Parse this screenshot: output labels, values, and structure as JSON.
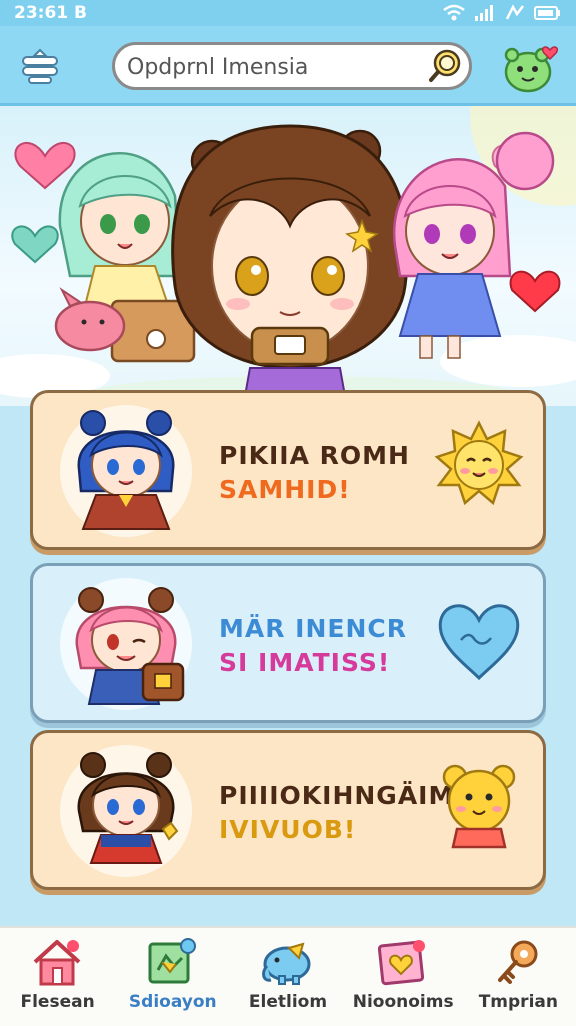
{
  "status_bar": {
    "time": "23:61 B"
  },
  "topbar": {
    "search": {
      "value": "Opdprnl Imensia"
    },
    "icons": [
      "menu-icon",
      "search-icon",
      "green-pet-heart-icon"
    ]
  },
  "cards": [
    {
      "line1": "PIKIIA ROMH",
      "line2": "SAMHID!",
      "line1_color": "#4a2a16",
      "line2_color": "#ef6a1e",
      "deco": "sun-smiley-icon"
    },
    {
      "line1": "MÄR INENCR",
      "line2": "SI IMATISS!",
      "line1_color": "#3d8bd4",
      "line2_color": "#d63b9c",
      "deco": "blue-heart-icon"
    },
    {
      "line1": "PIIIIOKIHNGÄIM",
      "line2": "IVIVUOB!",
      "line1_color": "#4a2a16",
      "line2_color": "#d99a10",
      "deco": "yellow-bear-icon"
    }
  ],
  "bottom_nav": [
    {
      "label": "Flesean",
      "icon": "house-icon",
      "active": false
    },
    {
      "label": "Sdioayon",
      "icon": "book-map-icon",
      "active": true
    },
    {
      "label": "Eletliom",
      "icon": "elephant-icon",
      "active": false
    },
    {
      "label": "Nioonoims",
      "icon": "heart-board-icon",
      "active": false
    },
    {
      "label": "Tmprian",
      "icon": "key-icon",
      "active": false
    }
  ],
  "colors": {
    "topbar": "#8ed8f3",
    "status_bar": "#7fd0ee",
    "card_warm": "#fde6c6",
    "card_cool": "#d9f0fb",
    "active_nav": "#3a7fc4"
  }
}
